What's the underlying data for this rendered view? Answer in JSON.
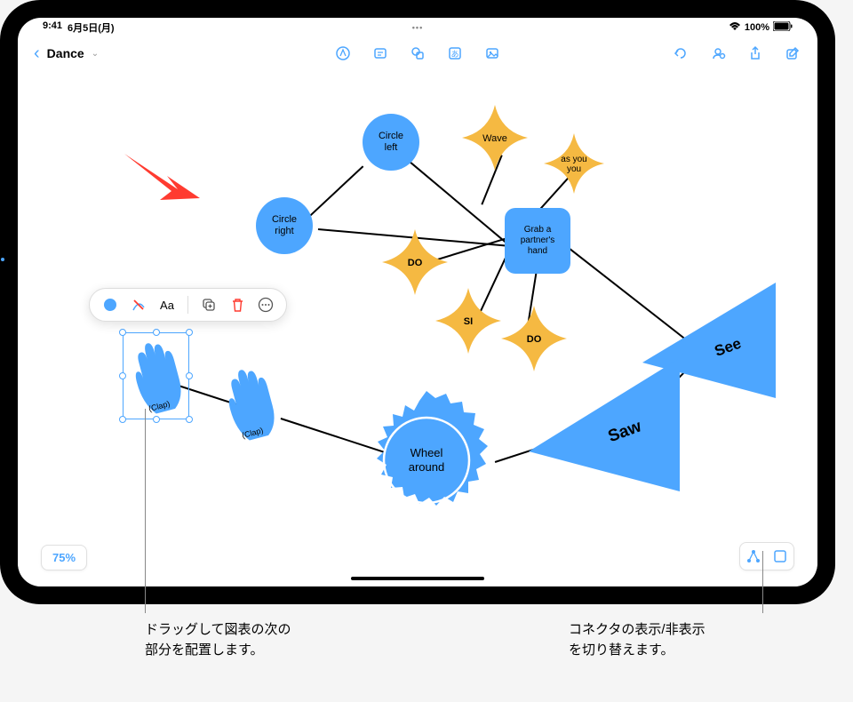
{
  "status": {
    "time": "9:41",
    "date": "6月5日(月)",
    "battery": "100%"
  },
  "title": "Dance",
  "zoom": "75%",
  "context_menu": {
    "text_item": "Aa"
  },
  "shapes": {
    "circle_left": "Circle\nleft",
    "circle_right": "Circle\nright",
    "wave": "Wave",
    "as_you": "as\nyou",
    "do1": "DO",
    "si": "SI",
    "do2": "DO",
    "grab": "Grab a\npartner's\nhand",
    "see": "See",
    "saw": "Saw",
    "wheel": "Wheel\naround",
    "clap1": "(Clap)",
    "clap2": "(Clap)"
  },
  "callouts": {
    "left": "ドラッグして図表の次の\n部分を配置します。",
    "right": "コネクタの表示/非表示\nを切り替えます。"
  }
}
